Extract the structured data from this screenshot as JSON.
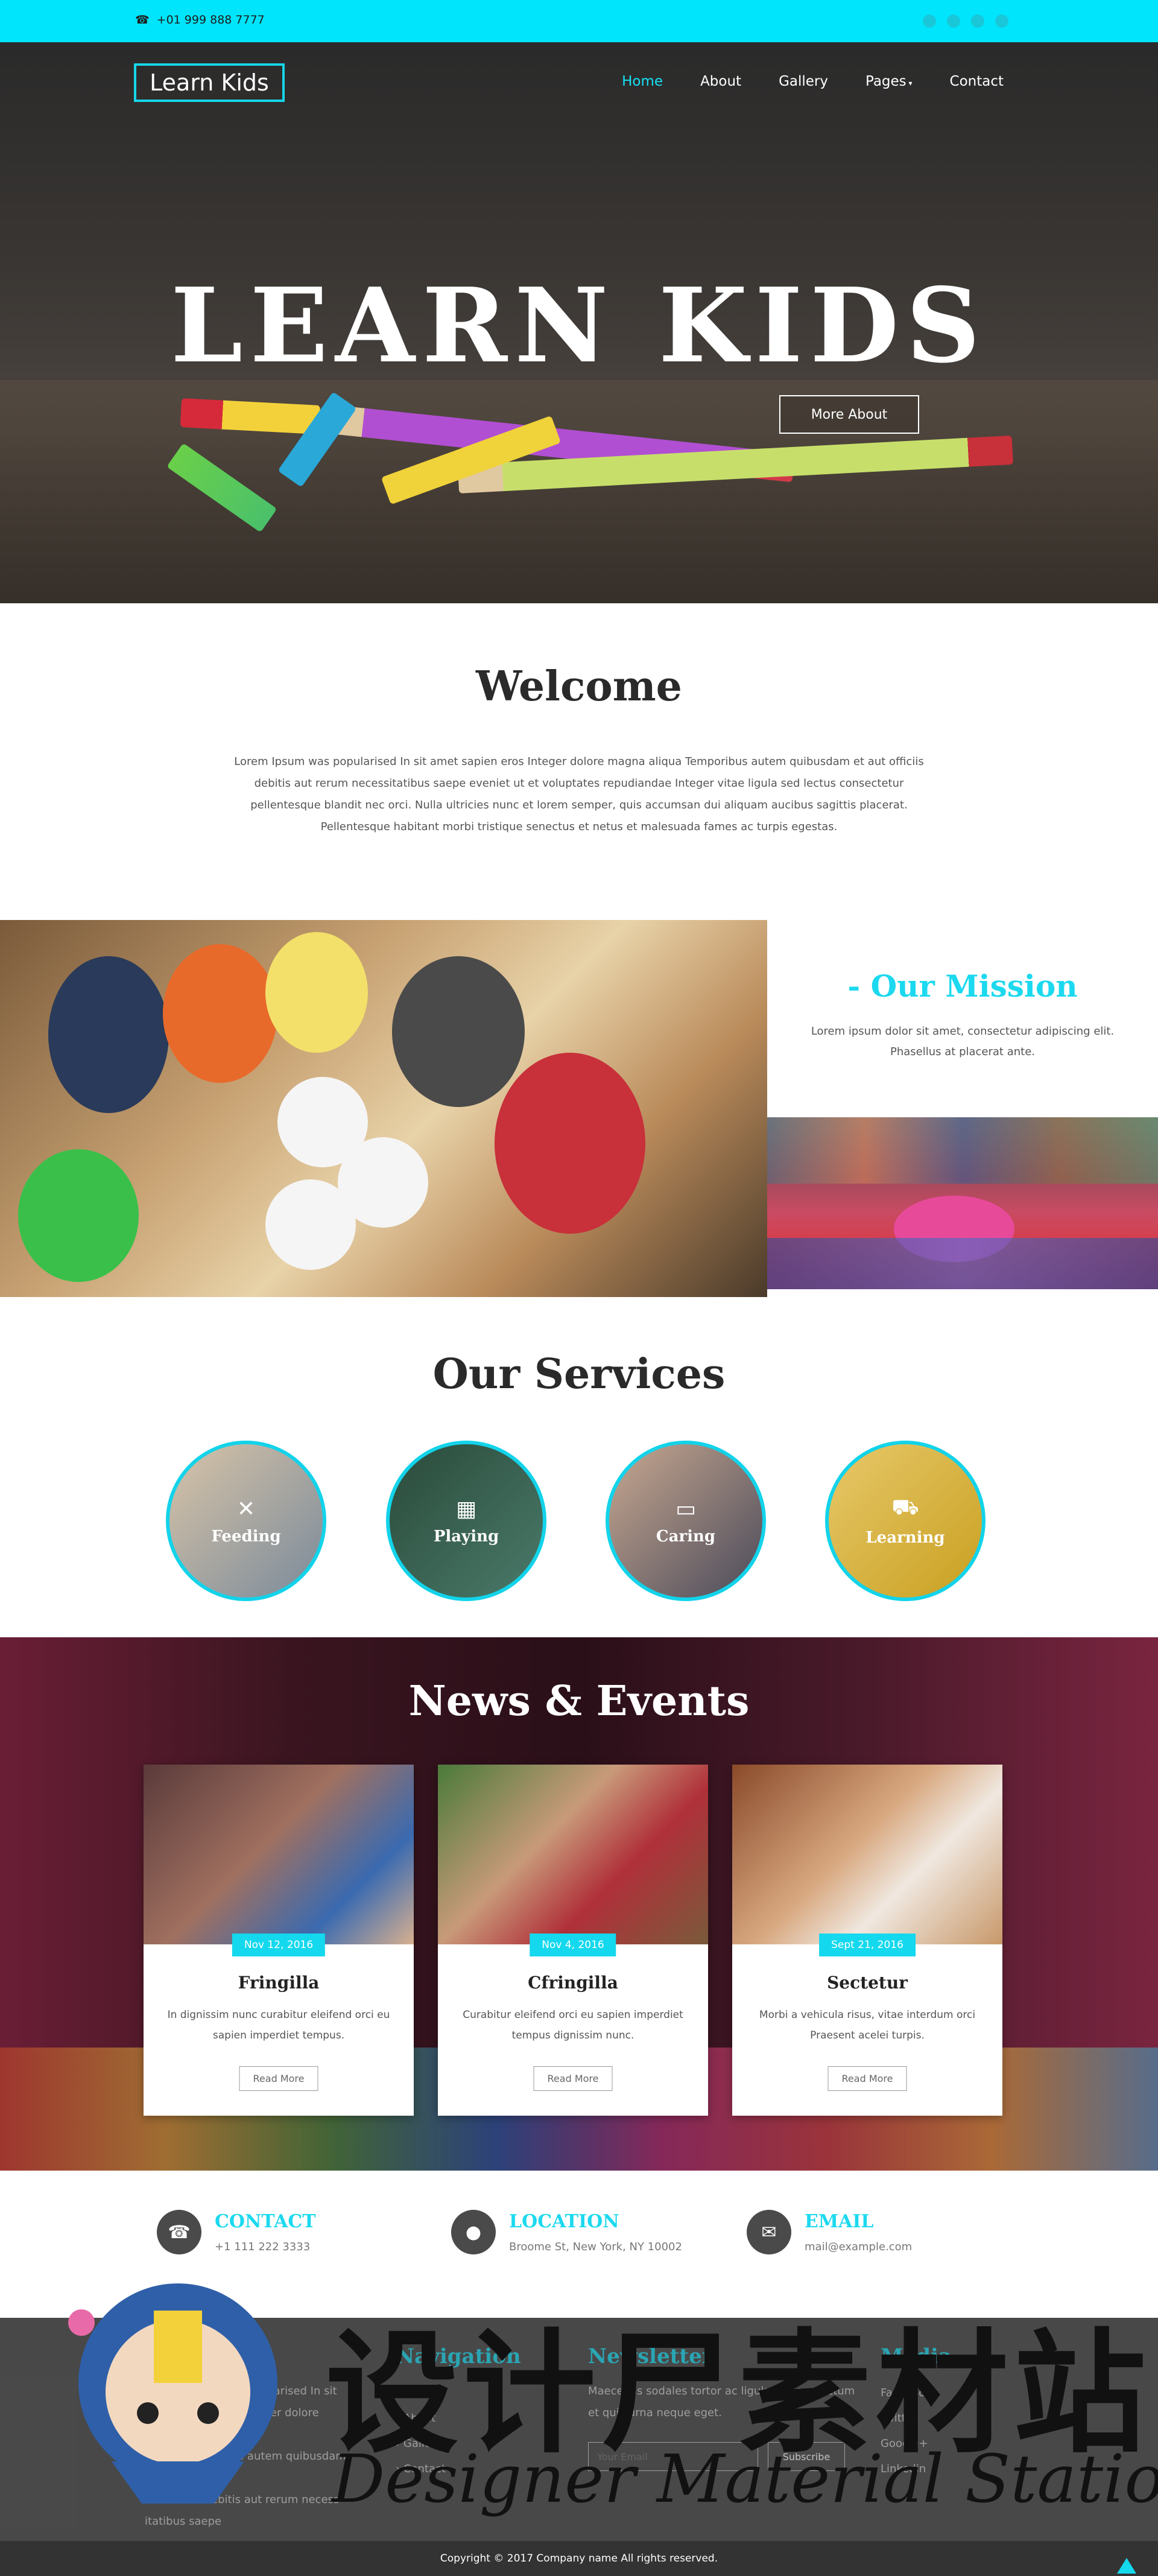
{
  "topbar": {
    "phone_icon": "phone-icon",
    "phone": "+01 999 888 7777",
    "social_icons": [
      "facebook-icon",
      "twitter-icon",
      "google-plus-icon",
      "linkedin-icon"
    ]
  },
  "header": {
    "logo": "Learn Kids",
    "nav": [
      "Home",
      "About",
      "Gallery",
      "Pages",
      "Contact"
    ],
    "active": "Home"
  },
  "hero": {
    "title": "LEARN KIDS",
    "button": "More About"
  },
  "welcome": {
    "title": "Welcome",
    "text": "Lorem Ipsum was popularised In sit amet sapien eros Integer dolore magna aliqua Temporibus autem quibusdam et aut officiis debitis aut rerum necessitatibus saepe eveniet ut et voluptates repudiandae Integer vitae ligula sed lectus consectetur pellentesque blandit nec orci. Nulla ultricies nunc et lorem semper, quis accumsan dui aliquam aucibus sagittis placerat. Pellentesque habitant morbi tristique senectus et netus et malesuada fames ac turpis egestas."
  },
  "mission": {
    "title": "- Our Mission",
    "text": "Lorem ipsum dolor sit amet, consectetur adipiscing elit. Phasellus at placerat ante."
  },
  "services": {
    "title": "Our Services",
    "items": [
      {
        "label": "Feeding",
        "icon": "cutlery-icon"
      },
      {
        "label": "Playing",
        "icon": "map-icon"
      },
      {
        "label": "Caring",
        "icon": "credit-card-icon"
      },
      {
        "label": "Learning",
        "icon": "truck-icon"
      }
    ]
  },
  "news": {
    "title": "News & Events",
    "cards": [
      {
        "date": "Nov 12, 2016",
        "title": "Fringilla",
        "text": "In dignissim nunc curabitur eleifend orci eu sapien imperdiet tempus.",
        "button": "Read More"
      },
      {
        "date": "Nov 4, 2016",
        "title": "Cfringilla",
        "text": "Curabitur eleifend orci eu sapien imperdiet tempus dignissim nunc.",
        "button": "Read More"
      },
      {
        "date": "Sept 21, 2016",
        "title": "Sectetur",
        "text": "Morbi a vehicula risus, vitae interdum orci Praesent acelei turpis.",
        "button": "Read More"
      }
    ]
  },
  "contact": [
    {
      "icon": "phone-icon",
      "heading": "CONTACT",
      "value": "+1 111 222 3333"
    },
    {
      "icon": "map-marker-icon",
      "heading": "LOCATION",
      "value": "Broome St, New York, NY 10002"
    },
    {
      "icon": "envelope-icon",
      "heading": "EMAIL",
      "value": "mail@example.com"
    }
  ],
  "footer": {
    "useful": {
      "heading": "Useful Info",
      "lines": [
        "Lorem ipsum was popularised In sit",
        "amet sapien eros Integer dolore magna",
        "aliqua Temporibus autem quibusdam et",
        "aut officiis debitis aut rerum necess",
        "itatibus saepe"
      ]
    },
    "navigation": {
      "heading": "Navigation",
      "links": [
        "Home",
        "About",
        "Gallery",
        "Contact"
      ]
    },
    "newsletter": {
      "heading": "Newsletter",
      "text": "Maecenas sodales tortor ac ligula ultrices dictum et quis urna neque eget.",
      "placeholder": "Your Email",
      "button": "Subscribe"
    },
    "media": {
      "heading": "Media",
      "items": [
        "Facebook",
        "Twitter",
        "Google+",
        "Linkedin"
      ]
    },
    "copyright": "Copyright © 2017 Company name All rights reserved."
  },
  "watermark": {
    "cn": "设计尸素材站",
    "en": "Designer Material Station"
  },
  "colors": {
    "accent": "#00e5fb",
    "dark": "#2a2a2a",
    "footer": "#4b4b4b"
  }
}
